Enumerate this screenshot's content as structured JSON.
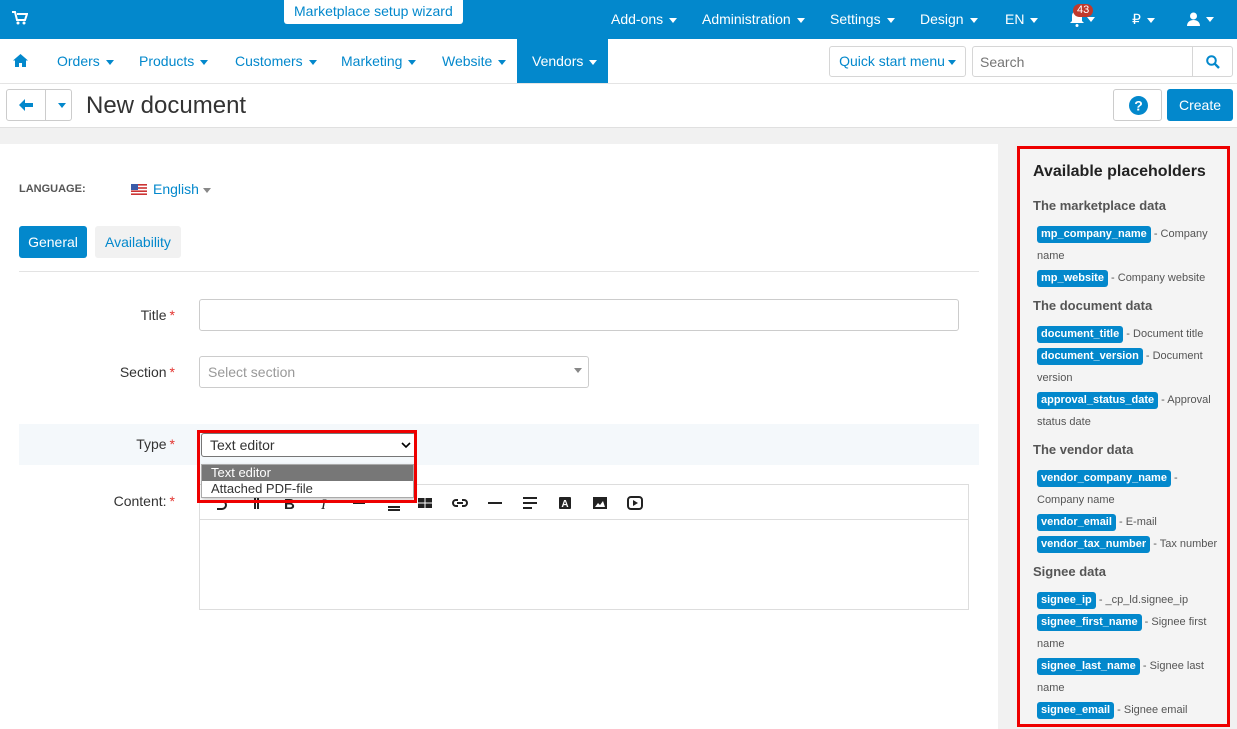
{
  "top": {
    "wizard": "Marketplace setup wizard",
    "menu": [
      "Add-ons",
      "Administration",
      "Settings",
      "Design",
      "EN"
    ],
    "notifications_count": "43",
    "currency": "₽"
  },
  "nav": {
    "items": [
      "Orders",
      "Products",
      "Customers",
      "Marketing",
      "Website",
      "Vendors"
    ],
    "quick_start": "Quick start menu",
    "search_placeholder": "Search"
  },
  "page": {
    "title": "New document",
    "create": "Create"
  },
  "form": {
    "language_label": "LANGUAGE:",
    "language_value": "English",
    "tabs": [
      "General",
      "Availability"
    ],
    "title_label": "Title",
    "section_label": "Section",
    "section_placeholder": "Select section",
    "type_label": "Type",
    "type_value": "Text editor",
    "type_options": [
      "Text editor",
      "Attached PDF-file"
    ],
    "content_label": "Content:"
  },
  "sidebar": {
    "title": "Available placeholders",
    "groups": [
      {
        "heading": "The marketplace data",
        "items": [
          {
            "tag": "mp_company_name",
            "desc": "- Company name"
          },
          {
            "tag": "mp_website",
            "desc": "- Company website"
          }
        ]
      },
      {
        "heading": "The document data",
        "items": [
          {
            "tag": "document_title",
            "desc": "- Document title"
          },
          {
            "tag": "document_version",
            "desc": "- Document version"
          },
          {
            "tag": "approval_status_date",
            "desc": "- Approval status date"
          }
        ]
      },
      {
        "heading": "The vendor data",
        "items": [
          {
            "tag": "vendor_company_name",
            "desc": "- Company name"
          },
          {
            "tag": "vendor_email",
            "desc": "- E-mail"
          },
          {
            "tag": "vendor_tax_number",
            "desc": "- Tax number"
          }
        ]
      },
      {
        "heading": "Signee data",
        "items": [
          {
            "tag": "signee_ip",
            "desc": "- _cp_ld.signee_ip"
          },
          {
            "tag": "signee_first_name",
            "desc": "- Signee first name"
          },
          {
            "tag": "signee_last_name",
            "desc": "- Signee last name"
          },
          {
            "tag": "signee_email",
            "desc": "- Signee email"
          }
        ]
      }
    ]
  },
  "colors": {
    "primary": "#0388cc",
    "highlight": "#ee0000"
  }
}
